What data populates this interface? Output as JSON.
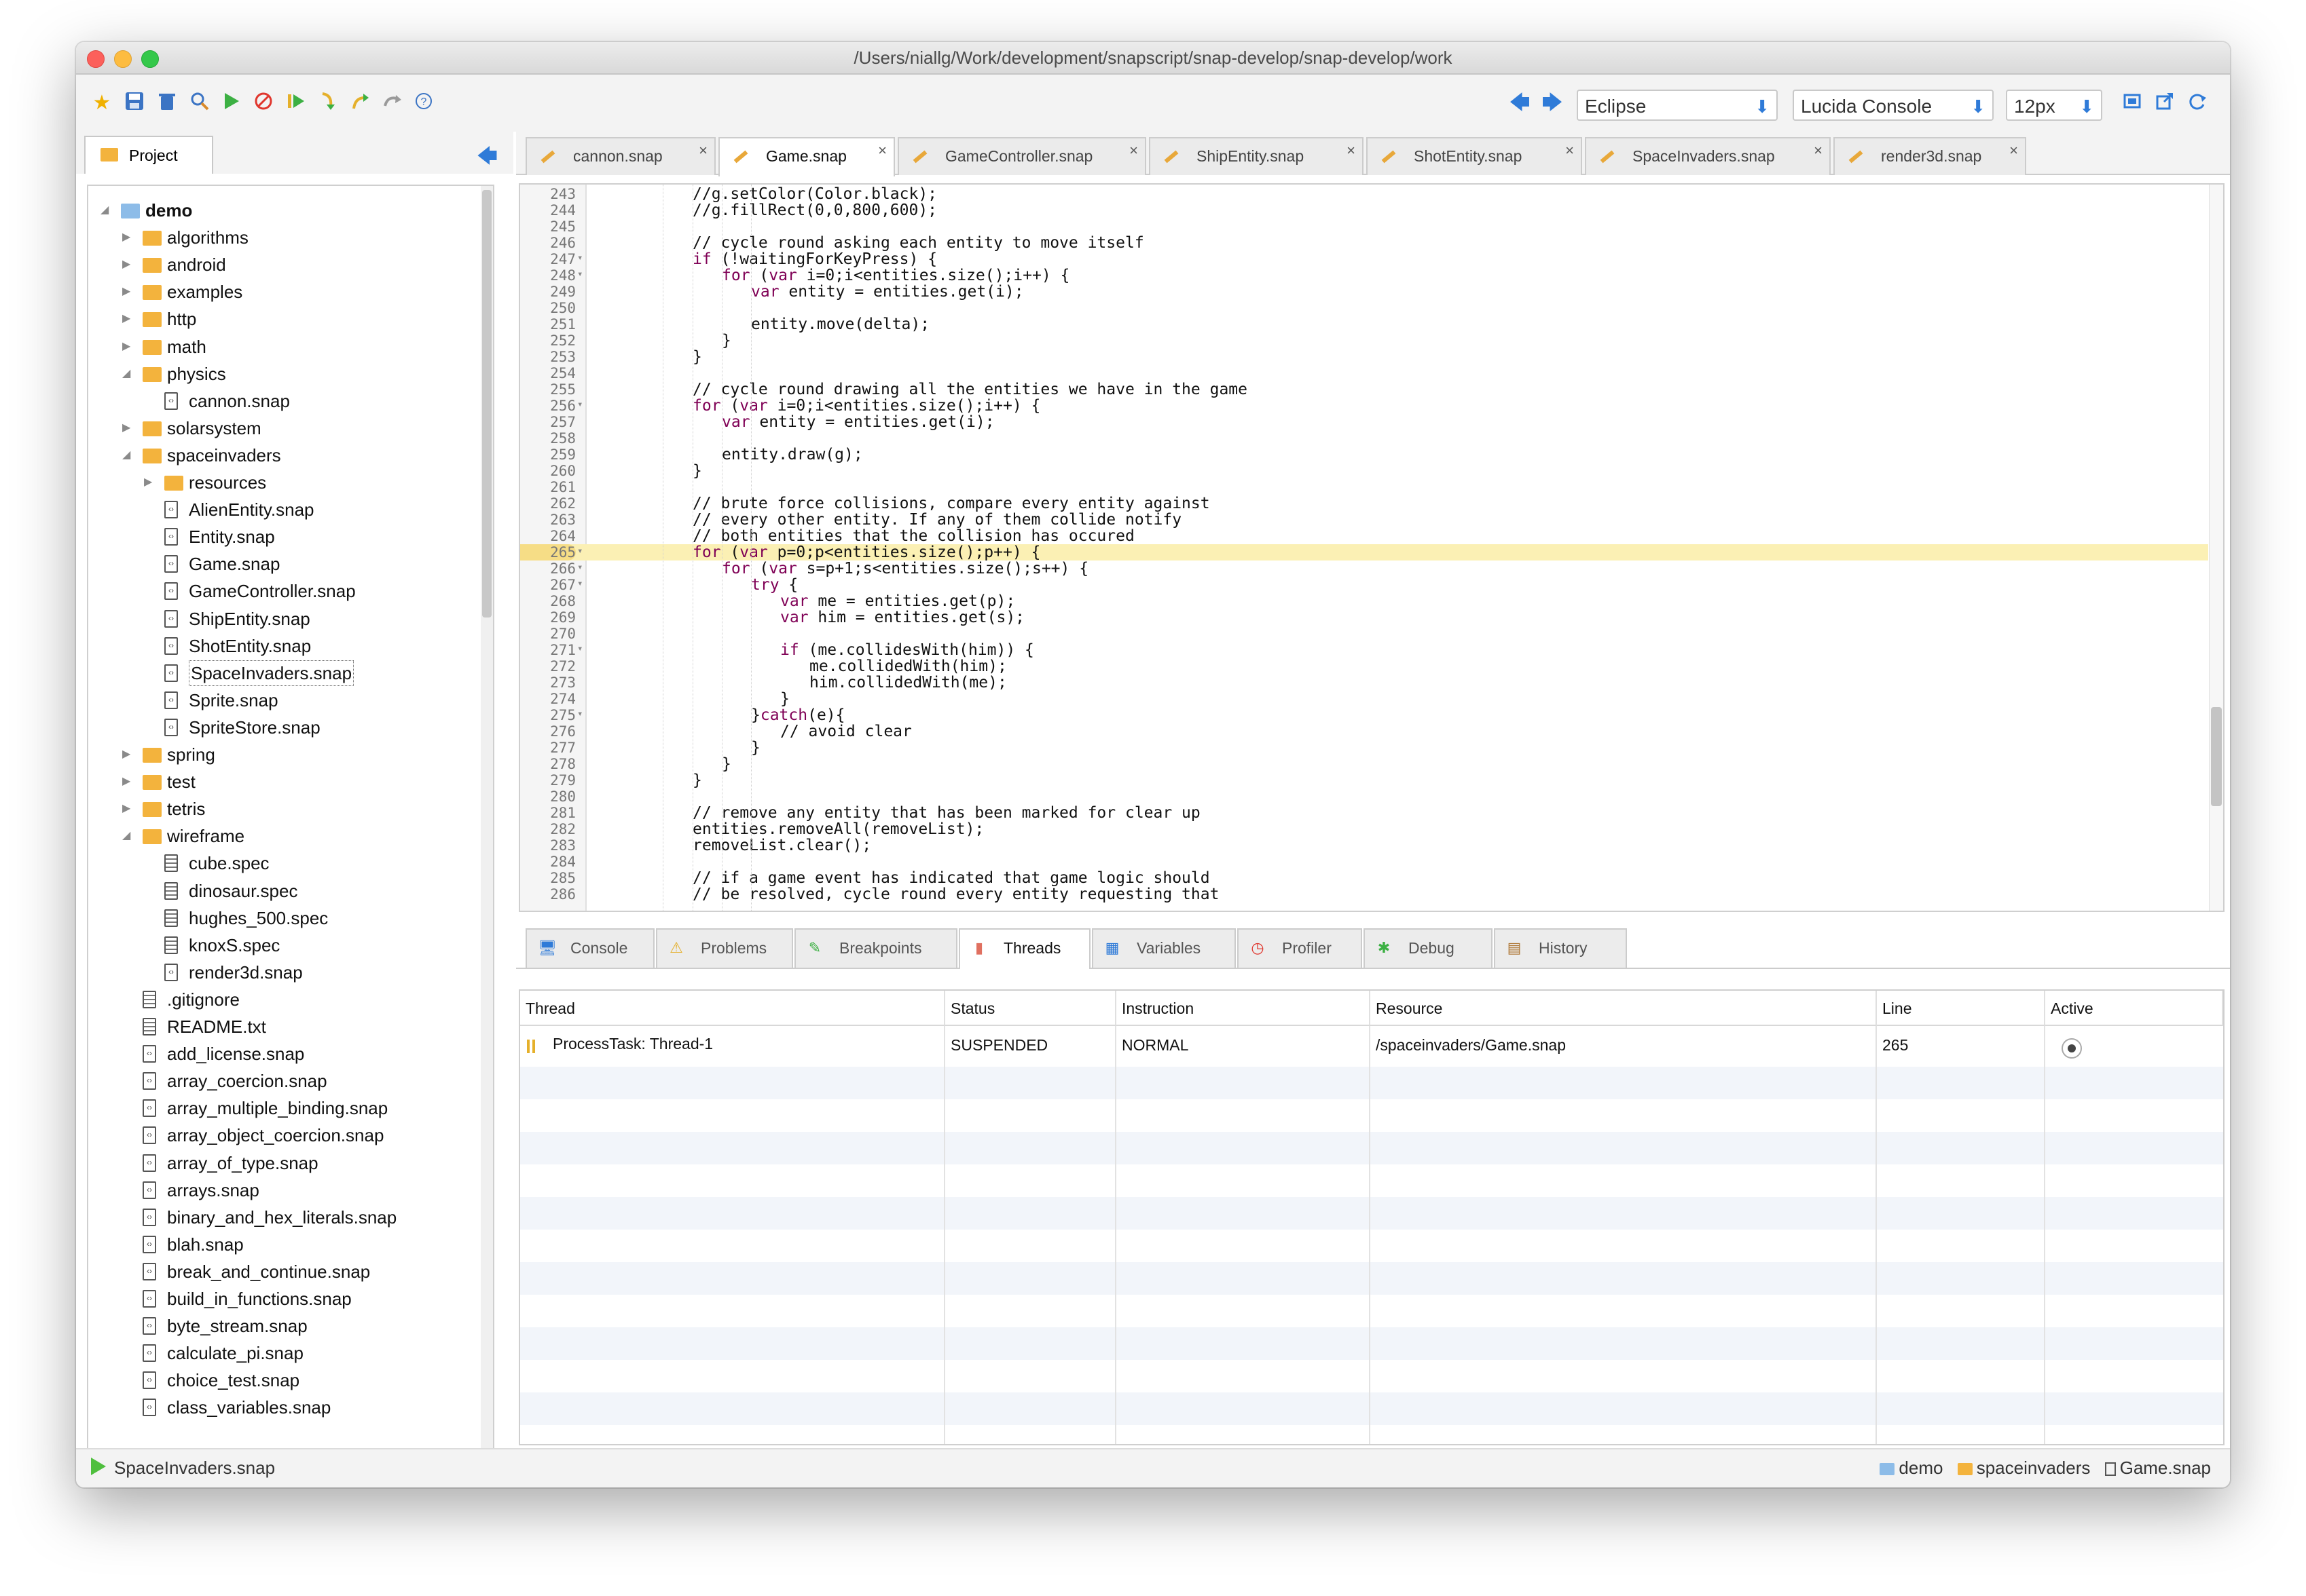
{
  "window": {
    "title": "/Users/niallg/Work/development/snapscript/snap-develop/snap-develop/work"
  },
  "toolbar": {
    "theme": "Eclipse",
    "font": "Lucida Console",
    "font_size": "12px"
  },
  "project": {
    "tab_label": "Project",
    "tree": [
      {
        "label": "demo",
        "type": "folder-open",
        "depth": 0,
        "expander": "open",
        "bold": true
      },
      {
        "label": "algorithms",
        "type": "folder",
        "depth": 1,
        "expander": "closed"
      },
      {
        "label": "android",
        "type": "folder",
        "depth": 1,
        "expander": "closed"
      },
      {
        "label": "examples",
        "type": "folder",
        "depth": 1,
        "expander": "closed"
      },
      {
        "label": "http",
        "type": "folder",
        "depth": 1,
        "expander": "closed"
      },
      {
        "label": "math",
        "type": "folder",
        "depth": 1,
        "expander": "closed"
      },
      {
        "label": "physics",
        "type": "folder",
        "depth": 1,
        "expander": "open"
      },
      {
        "label": "cannon.snap",
        "type": "snap",
        "depth": 2
      },
      {
        "label": "solarsystem",
        "type": "folder",
        "depth": 1,
        "expander": "closed"
      },
      {
        "label": "spaceinvaders",
        "type": "folder",
        "depth": 1,
        "expander": "open"
      },
      {
        "label": "resources",
        "type": "folder",
        "depth": 2,
        "expander": "closed"
      },
      {
        "label": "AlienEntity.snap",
        "type": "snap",
        "depth": 2
      },
      {
        "label": "Entity.snap",
        "type": "snap",
        "depth": 2
      },
      {
        "label": "Game.snap",
        "type": "snap",
        "depth": 2
      },
      {
        "label": "GameController.snap",
        "type": "snap",
        "depth": 2
      },
      {
        "label": "ShipEntity.snap",
        "type": "snap",
        "depth": 2
      },
      {
        "label": "ShotEntity.snap",
        "type": "snap",
        "depth": 2
      },
      {
        "label": "SpaceInvaders.snap",
        "type": "snap",
        "depth": 2,
        "selected": true
      },
      {
        "label": "Sprite.snap",
        "type": "snap",
        "depth": 2
      },
      {
        "label": "SpriteStore.snap",
        "type": "snap",
        "depth": 2
      },
      {
        "label": "spring",
        "type": "folder",
        "depth": 1,
        "expander": "closed"
      },
      {
        "label": "test",
        "type": "folder",
        "depth": 1,
        "expander": "closed"
      },
      {
        "label": "tetris",
        "type": "folder",
        "depth": 1,
        "expander": "closed"
      },
      {
        "label": "wireframe",
        "type": "folder",
        "depth": 1,
        "expander": "open"
      },
      {
        "label": "cube.spec",
        "type": "doc",
        "depth": 2
      },
      {
        "label": "dinosaur.spec",
        "type": "doc",
        "depth": 2
      },
      {
        "label": "hughes_500.spec",
        "type": "doc",
        "depth": 2
      },
      {
        "label": "knoxS.spec",
        "type": "doc",
        "depth": 2
      },
      {
        "label": "render3d.snap",
        "type": "snap",
        "depth": 2
      },
      {
        "label": ".gitignore",
        "type": "doc",
        "depth": 1
      },
      {
        "label": "README.txt",
        "type": "doc",
        "depth": 1
      },
      {
        "label": "add_license.snap",
        "type": "snap",
        "depth": 1
      },
      {
        "label": "array_coercion.snap",
        "type": "snap",
        "depth": 1
      },
      {
        "label": "array_multiple_binding.snap",
        "type": "snap",
        "depth": 1
      },
      {
        "label": "array_object_coercion.snap",
        "type": "snap",
        "depth": 1
      },
      {
        "label": "array_of_type.snap",
        "type": "snap",
        "depth": 1
      },
      {
        "label": "arrays.snap",
        "type": "snap",
        "depth": 1
      },
      {
        "label": "binary_and_hex_literals.snap",
        "type": "snap",
        "depth": 1
      },
      {
        "label": "blah.snap",
        "type": "snap",
        "depth": 1
      },
      {
        "label": "break_and_continue.snap",
        "type": "snap",
        "depth": 1
      },
      {
        "label": "build_in_functions.snap",
        "type": "snap",
        "depth": 1
      },
      {
        "label": "byte_stream.snap",
        "type": "snap",
        "depth": 1
      },
      {
        "label": "calculate_pi.snap",
        "type": "snap",
        "depth": 1
      },
      {
        "label": "choice_test.snap",
        "type": "snap",
        "depth": 1
      },
      {
        "label": "class_variables.snap",
        "type": "snap",
        "depth": 1
      }
    ]
  },
  "editor": {
    "tabs": [
      {
        "label": "cannon.snap",
        "active": false
      },
      {
        "label": "Game.snap",
        "active": true
      },
      {
        "label": "GameController.snap",
        "active": false
      },
      {
        "label": "ShipEntity.snap",
        "active": false
      },
      {
        "label": "ShotEntity.snap",
        "active": false
      },
      {
        "label": "SpaceInvaders.snap",
        "active": false
      },
      {
        "label": "render3d.snap",
        "active": false
      }
    ],
    "highlighted_line": 265,
    "lines": [
      {
        "n": "243",
        "code": "//g.setColor(Color.black);",
        "indent": 3,
        "kind": "cm"
      },
      {
        "n": "244",
        "code": "//g.fillRect(0,0,800,600);",
        "indent": 3,
        "kind": "cm"
      },
      {
        "n": "245",
        "code": "",
        "indent": 3
      },
      {
        "n": "246",
        "code": "// cycle round asking each entity to move itself",
        "indent": 3,
        "kind": "cm"
      },
      {
        "n": "247",
        "code": "if (!waitingForKeyPress) {",
        "indent": 3,
        "fold": true
      },
      {
        "n": "248",
        "code": "for (var i=0;i<entities.size();i++) {",
        "indent": 4,
        "fold": true
      },
      {
        "n": "249",
        "code": "var entity = entities.get(i);",
        "indent": 5
      },
      {
        "n": "250",
        "code": "",
        "indent": 5
      },
      {
        "n": "251",
        "code": "entity.move(delta);",
        "indent": 5
      },
      {
        "n": "252",
        "code": "}",
        "indent": 4
      },
      {
        "n": "253",
        "code": "}",
        "indent": 3
      },
      {
        "n": "254",
        "code": "",
        "indent": 3
      },
      {
        "n": "255",
        "code": "// cycle round drawing all the entities we have in the game",
        "indent": 3,
        "kind": "cm"
      },
      {
        "n": "256",
        "code": "for (var i=0;i<entities.size();i++) {",
        "indent": 3,
        "fold": true
      },
      {
        "n": "257",
        "code": "var entity = entities.get(i);",
        "indent": 4
      },
      {
        "n": "258",
        "code": "",
        "indent": 4
      },
      {
        "n": "259",
        "code": "entity.draw(g);",
        "indent": 4
      },
      {
        "n": "260",
        "code": "}",
        "indent": 3
      },
      {
        "n": "261",
        "code": "",
        "indent": 3
      },
      {
        "n": "262",
        "code": "// brute force collisions, compare every entity against",
        "indent": 3,
        "kind": "cm"
      },
      {
        "n": "263",
        "code": "// every other entity. If any of them collide notify",
        "indent": 3,
        "kind": "cm"
      },
      {
        "n": "264",
        "code": "// both entities that the collision has occured",
        "indent": 3,
        "kind": "cm"
      },
      {
        "n": "265",
        "code": "for (var p=0;p<entities.size();p++) {",
        "indent": 3,
        "fold": true
      },
      {
        "n": "266",
        "code": "for (var s=p+1;s<entities.size();s++) {",
        "indent": 4,
        "fold": true
      },
      {
        "n": "267",
        "code": "try {",
        "indent": 5,
        "fold": true
      },
      {
        "n": "268",
        "code": "var me = entities.get(p);",
        "indent": 6
      },
      {
        "n": "269",
        "code": "var him = entities.get(s);",
        "indent": 6
      },
      {
        "n": "270",
        "code": "",
        "indent": 6
      },
      {
        "n": "271",
        "code": "if (me.collidesWith(him)) {",
        "indent": 6,
        "fold": true
      },
      {
        "n": "272",
        "code": "me.collidedWith(him);",
        "indent": 7
      },
      {
        "n": "273",
        "code": "him.collidedWith(me);",
        "indent": 7
      },
      {
        "n": "274",
        "code": "}",
        "indent": 6
      },
      {
        "n": "275",
        "code": "}catch(e){",
        "indent": 5,
        "fold": true
      },
      {
        "n": "276",
        "code": "// avoid clear",
        "indent": 6,
        "kind": "cm"
      },
      {
        "n": "277",
        "code": "}",
        "indent": 5
      },
      {
        "n": "278",
        "code": "}",
        "indent": 4
      },
      {
        "n": "279",
        "code": "}",
        "indent": 3
      },
      {
        "n": "280",
        "code": "",
        "indent": 3
      },
      {
        "n": "281",
        "code": "// remove any entity that has been marked for clear up",
        "indent": 3,
        "kind": "cm"
      },
      {
        "n": "282",
        "code": "entities.removeAll(removeList);",
        "indent": 3
      },
      {
        "n": "283",
        "code": "removeList.clear();",
        "indent": 3
      },
      {
        "n": "284",
        "code": "",
        "indent": 3
      },
      {
        "n": "285",
        "code": "// if a game event has indicated that game logic should",
        "indent": 3,
        "kind": "cm"
      },
      {
        "n": "286",
        "code": "// be resolved, cycle round every entity requesting that",
        "indent": 3,
        "kind": "cm"
      }
    ]
  },
  "bottom_panel": {
    "tabs": [
      {
        "label": "Console",
        "icon": "monitor-icon",
        "active": false
      },
      {
        "label": "Problems",
        "icon": "warning-icon",
        "active": false
      },
      {
        "label": "Breakpoints",
        "icon": "breakpoint-icon",
        "active": false
      },
      {
        "label": "Threads",
        "icon": "threads-icon",
        "active": true
      },
      {
        "label": "Variables",
        "icon": "grid-icon",
        "active": false
      },
      {
        "label": "Profiler",
        "icon": "clock-icon",
        "active": false
      },
      {
        "label": "Debug",
        "icon": "bug-icon",
        "active": false
      },
      {
        "label": "History",
        "icon": "book-icon",
        "active": false
      }
    ],
    "threads": {
      "columns": [
        "Thread",
        "Status",
        "Instruction",
        "Resource",
        "Line",
        "Active"
      ],
      "rows": [
        {
          "thread": "ProcessTask: Thread-1",
          "status": "SUSPENDED",
          "instruction": "NORMAL",
          "resource": "/spaceinvaders/Game.snap",
          "line": "265"
        }
      ]
    }
  },
  "status_bar": {
    "left": "SpaceInvaders.snap",
    "path": [
      "demo",
      "spaceinvaders",
      "Game.snap"
    ]
  },
  "colors": {
    "comment": "#3f7f5f",
    "keyword": "#7f0055",
    "highlight": "#fbf0b4",
    "accent": "#2f7bd8",
    "folder": "#f3b33d"
  }
}
